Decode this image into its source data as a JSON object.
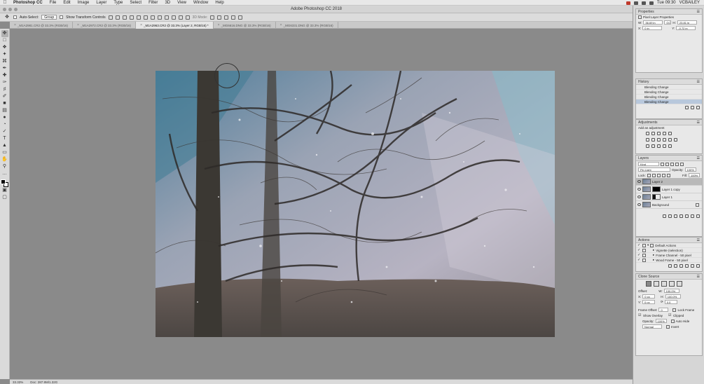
{
  "menubar": {
    "app": "Photoshop CC",
    "items": [
      "File",
      "Edit",
      "Image",
      "Layer",
      "Type",
      "Select",
      "Filter",
      "3D",
      "View",
      "Window",
      "Help"
    ],
    "clock": "Tue 09:30",
    "user": "VCBAILEY"
  },
  "window": {
    "title": "Adobe Photoshop CC 2018"
  },
  "options": {
    "auto_select_label": "Auto-Select:",
    "auto_select_value": "Group",
    "transform_label": "Show Transform Controls",
    "mode3d_label": "3D Mode:"
  },
  "tabs": [
    {
      "label": "_M1A2981.CR2 @ 33.3% (RGB/16)",
      "active": false
    },
    {
      "label": "_M1A2972.CR2 @ 33.3% (RGB/16)",
      "active": false
    },
    {
      "label": "_M1A2963.CR2 @ 33.3% (Layer 2, RGB/16) *",
      "active": true
    },
    {
      "label": "_MG6616.DNG @ 33.3% (RGB/16)",
      "active": false
    },
    {
      "label": "_MG6331.DNG @ 33.3% (RGB/16)",
      "active": false
    }
  ],
  "status": {
    "zoom": "33.33%",
    "doc": "Doc: 287.9M/1.32G"
  },
  "properties": {
    "title": "Properties",
    "subtitle": "Pixel Layer Properties",
    "w_label": "W:",
    "w_value": "36.69 in",
    "h_label": "H:",
    "h_value": "23.81 in",
    "x_label": "X:",
    "x_value": "0 in",
    "y_label": "Y:",
    "y_value": "-0.72 in",
    "link_label": "GO"
  },
  "history": {
    "title": "History",
    "items": [
      "Blending Change",
      "Blending Change",
      "Blending Change",
      "Blending Change"
    ],
    "current_index": 3
  },
  "adjustments": {
    "title": "Adjustments",
    "subtitle": "Add an adjustment"
  },
  "layers": {
    "title": "Layers",
    "filter": "Kind",
    "blend_mode": "Pin Light",
    "opacity_label": "Opacity:",
    "opacity_value": "100%",
    "lock_label": "Lock:",
    "fill_label": "Fill:",
    "fill_value": "100%",
    "items": [
      {
        "name": "Layer 2",
        "selected": true
      },
      {
        "name": "Layer 1 copy",
        "selected": false
      },
      {
        "name": "Layer 1",
        "selected": false
      },
      {
        "name": "Background",
        "selected": false
      }
    ]
  },
  "actions": {
    "title": "Actions",
    "items": [
      "Default Actions",
      "Vignette (selection)",
      "Frame Channel - 50 pixel",
      "Wood Frame - 50 pixel"
    ]
  },
  "clone_source": {
    "title": "Clone Source",
    "offset_label": "Offset:",
    "w_label": "W:",
    "w_value": "100.0%",
    "h_label": "H:",
    "h_value": "100.0%",
    "x_label": "X:",
    "x_value": "0 px",
    "y_label": "Y:",
    "y_value": "0 px",
    "angle_value": "0.0",
    "frame_offset_label": "Frame Offset:",
    "frame_offset_value": "0",
    "lock_frame_label": "Lock Frame",
    "show_overlay_label": "Show Overlay",
    "clipped_label": "Clipped",
    "opacity_label": "Opacity:",
    "opacity_value": "100%",
    "auto_hide_label": "Auto Hide",
    "mode_value": "Normal",
    "invert_label": "Invert"
  }
}
